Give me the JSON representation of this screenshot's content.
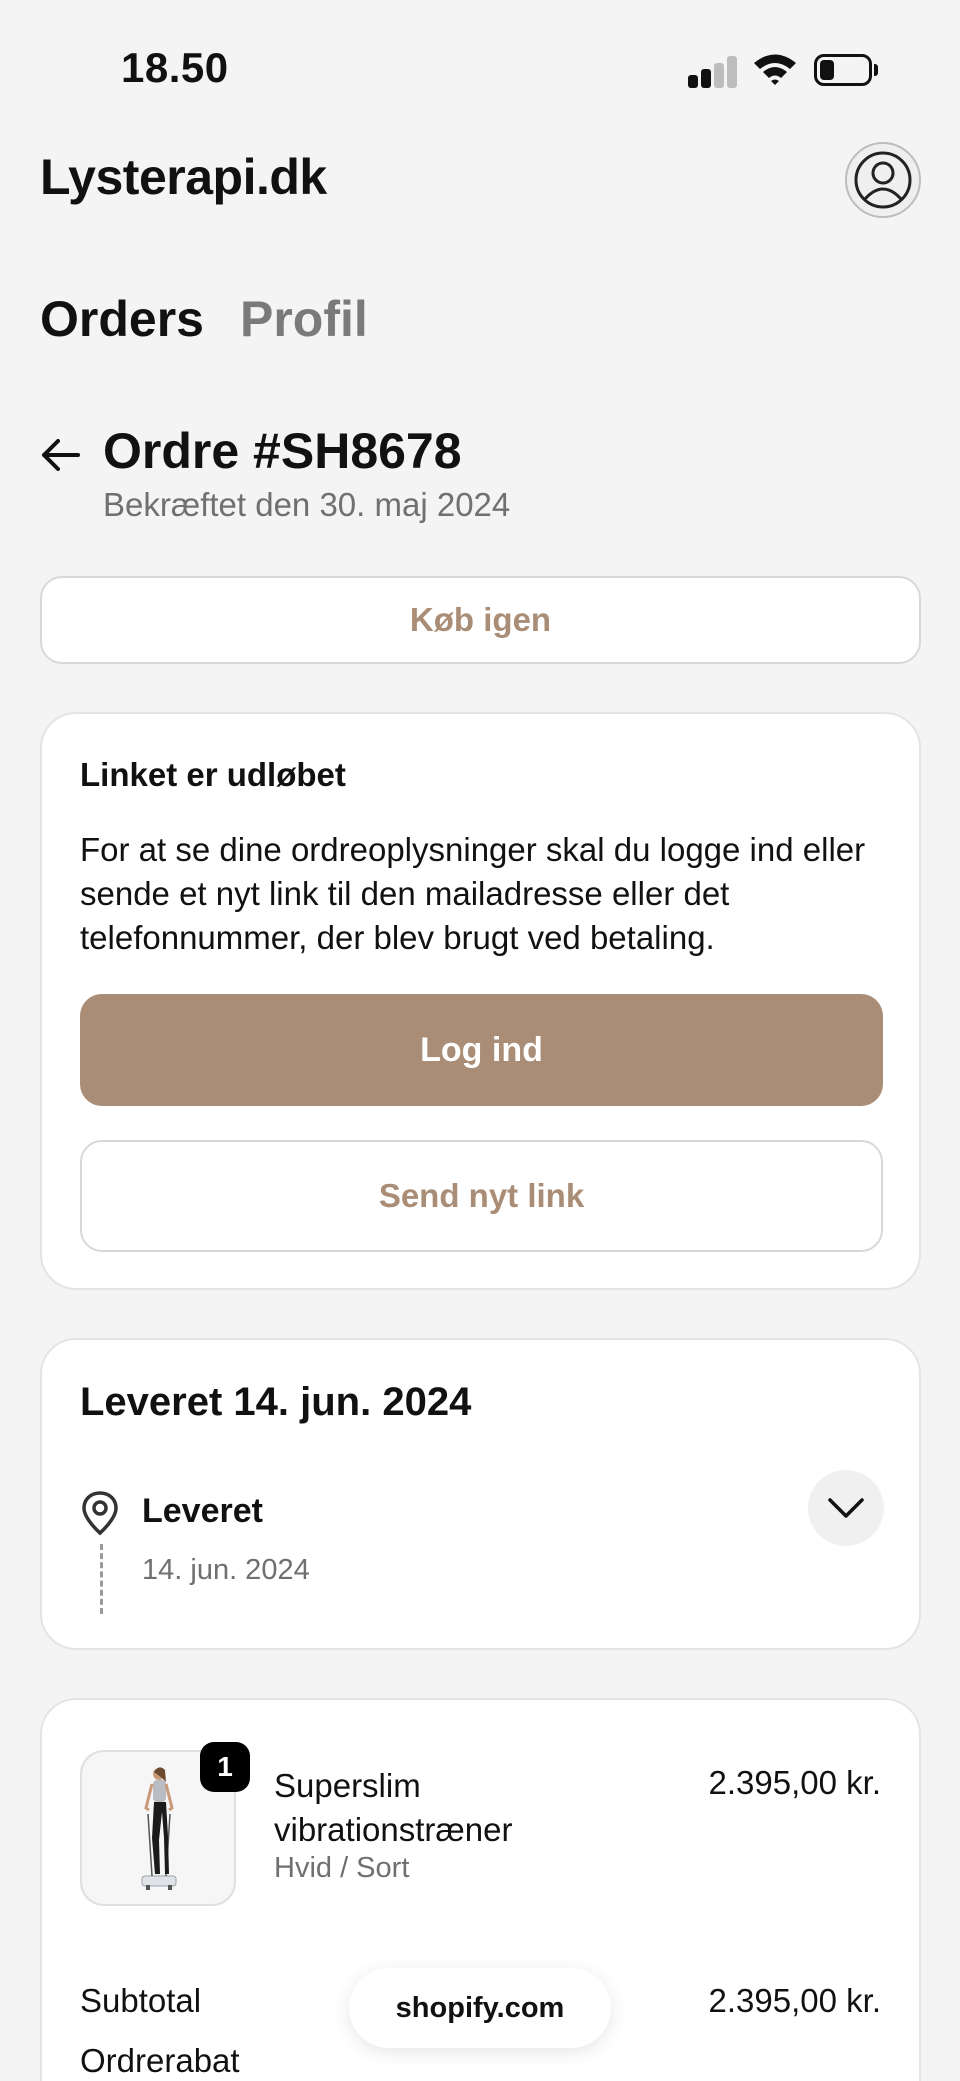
{
  "status_bar": {
    "time": "18.50",
    "icons": [
      "signal-icon",
      "wifi-icon",
      "battery-icon"
    ]
  },
  "header": {
    "brand": "Lysterapi.dk",
    "avatar_icon": "user-circle-icon"
  },
  "tabs": [
    {
      "label": "Orders",
      "active": true
    },
    {
      "label": "Profil",
      "active": false
    }
  ],
  "order": {
    "title": "Ordre #SH8678",
    "confirmed": "Bekræftet den 30. maj 2024",
    "buy_again": "Køb igen"
  },
  "expired_card": {
    "title": "Linket er udløbet",
    "text": "For at se dine ordreoplysninger skal du logge ind eller sende et nyt link til den mailadresse eller det telefonnummer, der blev brugt ved betaling.",
    "login_label": "Log ind",
    "send_link_label": "Send nyt link"
  },
  "delivery": {
    "heading": "Leveret 14. jun. 2024",
    "status": "Leveret",
    "date": "14. jun. 2024"
  },
  "items": [
    {
      "quantity": "1",
      "name": "Superslim vibrationstræner",
      "variant": "Hvid / Sort",
      "price": "2.395,00 kr."
    }
  ],
  "summary": {
    "subtotal_label": "Subtotal",
    "subtotal_value": "2.395,00 kr.",
    "discount_label": "Ordrerabat"
  },
  "footer": {
    "domain": "shopify.com"
  },
  "colors": {
    "accent": "#a98d76",
    "background": "#f4f4f4",
    "card": "#ffffff",
    "muted_text": "#707070"
  }
}
